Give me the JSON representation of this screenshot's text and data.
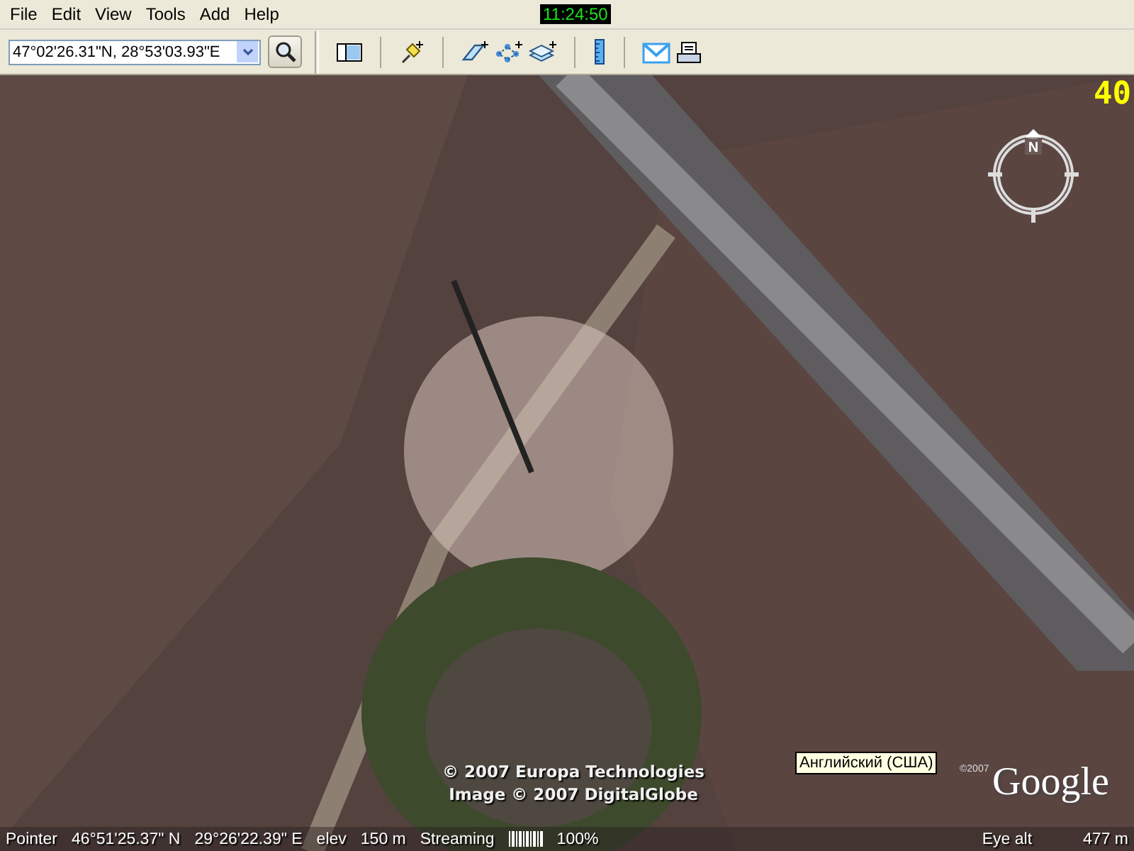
{
  "menu": [
    {
      "label": "File"
    },
    {
      "label": "Edit"
    },
    {
      "label": "View"
    },
    {
      "label": "Tools"
    },
    {
      "label": "Add"
    },
    {
      "label": "Help"
    }
  ],
  "clock": "11:24:50",
  "search": {
    "value": "47°02'26.31\"N, 28°53'03.93\"E"
  },
  "map": {
    "frame_rate": "40",
    "compass": {
      "label": "N"
    },
    "copyright": [
      "© 2007 Europa Technologies",
      "Image © 2007 DigitalGlobe"
    ],
    "tooltip": "Английский (США)",
    "logo": {
      "year": "©2007",
      "name": "Google"
    }
  },
  "status_bar": {
    "pointer_label": "Pointer",
    "latitude": "46°51'25.37\" N",
    "longitude": "29°26'22.39\" E",
    "elev_label": "elev",
    "elev": "150 m",
    "streaming_label": "Streaming",
    "streaming": {
      "level": 1
    },
    "streaming_percent": "100%",
    "eye_alt_label": "Eye alt",
    "eye_alt": "477 m"
  }
}
